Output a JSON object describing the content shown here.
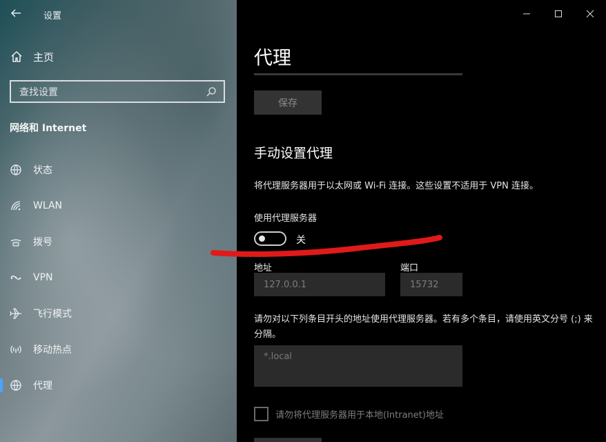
{
  "window": {
    "app_title": "设置",
    "controls": [
      "minimize-icon",
      "maximize-icon",
      "close-icon"
    ]
  },
  "sidebar": {
    "home_label": "主页",
    "search_placeholder": "查找设置",
    "section_title": "网络和 Internet",
    "items": [
      {
        "label": "状态",
        "icon": "globe-status-icon",
        "active": false
      },
      {
        "label": "WLAN",
        "icon": "wifi-icon",
        "active": false
      },
      {
        "label": "拨号",
        "icon": "dialup-icon",
        "active": false
      },
      {
        "label": "VPN",
        "icon": "vpn-icon",
        "active": false
      },
      {
        "label": "飞行模式",
        "icon": "airplane-icon",
        "active": false
      },
      {
        "label": "移动热点",
        "icon": "hotspot-icon",
        "active": false
      },
      {
        "label": "代理",
        "icon": "globe-icon",
        "active": true
      }
    ]
  },
  "main": {
    "page_title": "代理",
    "save_label": "保存",
    "manual_title": "手动设置代理",
    "description": "将代理服务器用于以太网或 Wi-Fi 连接。这些设置不适用于 VPN 连接。",
    "use_proxy_label": "使用代理服务器",
    "toggle_state": "关",
    "toggle_on": false,
    "address_label": "地址",
    "address_value": "127.0.0.1",
    "port_label": "端口",
    "port_value": "15732",
    "exceptions_description": "请勿对以下列条目开头的地址使用代理服务器。若有多个条目，请使用英文分号 (;) 来分隔。",
    "exceptions_value": "*.local",
    "local_checkbox_label": "请勿将代理服务器用于本地(Intranet)地址",
    "local_checkbox_checked": false
  },
  "colors": {
    "annotation_stroke": "#e01a1a",
    "active_indicator": "#4aa3ff"
  }
}
